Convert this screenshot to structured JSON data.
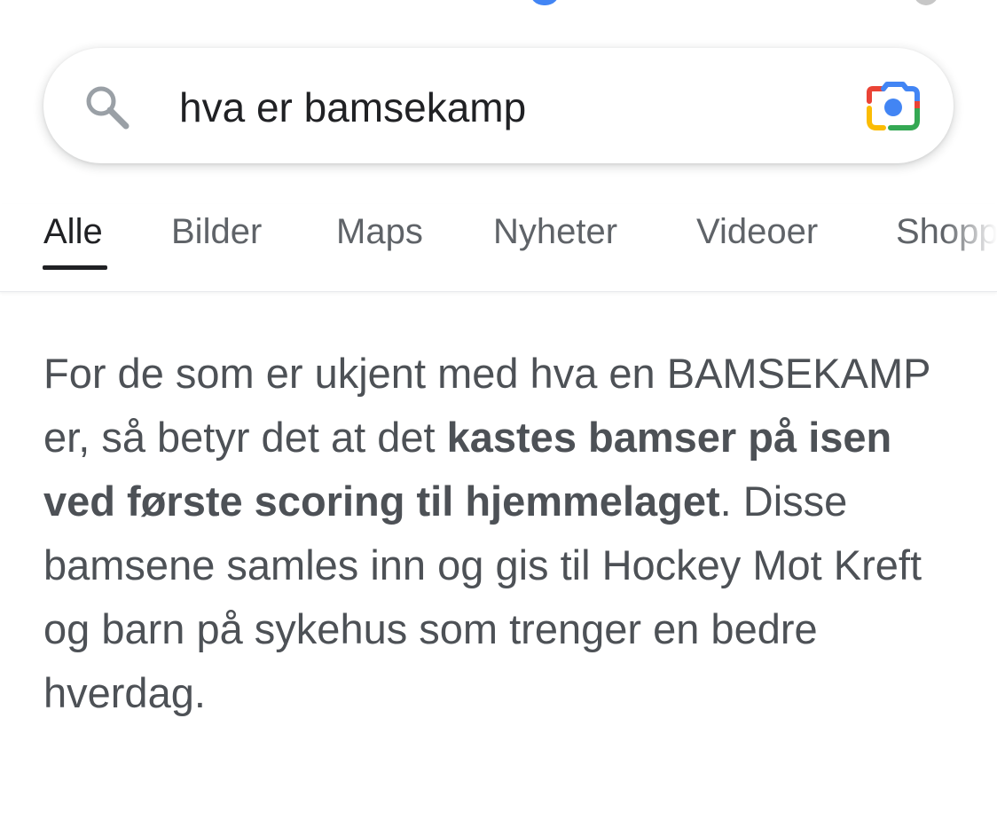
{
  "search": {
    "query": "hva er bamsekamp"
  },
  "tabs": [
    {
      "label": "Alle",
      "active": true
    },
    {
      "label": "Bilder",
      "active": false
    },
    {
      "label": "Maps",
      "active": false
    },
    {
      "label": "Nyheter",
      "active": false
    },
    {
      "label": "Videoer",
      "active": false
    },
    {
      "label": "Shopp",
      "active": false
    }
  ],
  "answer": {
    "intro": "For de som er ukjent med hva en BAMSEKAMP er, så betyr det at det ",
    "highlight": "kastes bamser på isen ved første scoring til hjemmelaget",
    "outro": ". Disse bamsene samles inn og gis til Hockey Mot Kreft og barn på sykehus som trenger en bedre hverdag."
  },
  "icons": {
    "search": "search-icon",
    "lens": "google-lens-icon"
  },
  "colors": {
    "tab_active": "#202124",
    "tab_inactive": "#5f6368",
    "body_text": "#4d5156",
    "lens_blue": "#4285f4",
    "lens_red": "#ea4335",
    "lens_yellow": "#fbbc04",
    "lens_green": "#34a853"
  }
}
